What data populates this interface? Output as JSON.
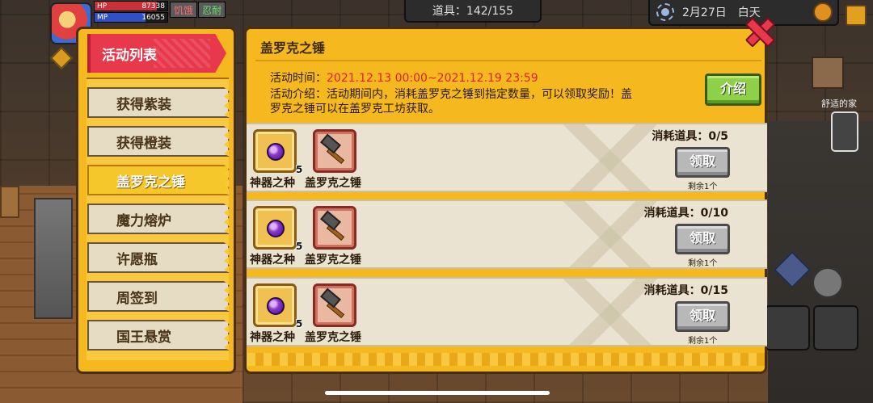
{
  "hud": {
    "hp_label": "HP",
    "hp_value": "87338",
    "hp_fill": 0.85,
    "mp_label": "MP",
    "mp_value": "16055",
    "mp_fill": 0.7,
    "status_hungry": "饥饿",
    "status_tired": "忍耐",
    "items_counter": "道具：142/155",
    "date": "2月27日",
    "time_of_day": "白天",
    "home_label": "舒适的家"
  },
  "sidebar": {
    "header": "活动列表",
    "items": [
      {
        "label": "获得紫装",
        "active": false
      },
      {
        "label": "获得橙装",
        "active": false
      },
      {
        "label": "盖罗克之锤",
        "active": true
      },
      {
        "label": "魔力熔炉",
        "active": false
      },
      {
        "label": "许愿瓶",
        "active": false
      },
      {
        "label": "周签到",
        "active": false
      },
      {
        "label": "国王悬赏",
        "active": false
      }
    ]
  },
  "detail": {
    "title": "盖罗克之锤",
    "time_label": "活动时间：",
    "time_value": "2021.12.13 00:00~2021.12.19 23:59",
    "desc_line1": "活动介绍：活动期间内，消耗盖罗克之锤到指定数量，可以领取奖励！盖",
    "desc_line2": "罗克之锤可以在盖罗克工坊获取。",
    "intro_button": "介绍"
  },
  "tasks": [
    {
      "reward_name": "神器之种",
      "reward_qty": "5",
      "cost_name": "盖罗克之锤",
      "consume": "消耗道具：0/5",
      "claim": "领取",
      "remain": "剩余1个"
    },
    {
      "reward_name": "神器之种",
      "reward_qty": "5",
      "cost_name": "盖罗克之锤",
      "consume": "消耗道具：0/10",
      "claim": "领取",
      "remain": "剩余1个"
    },
    {
      "reward_name": "神器之种",
      "reward_qty": "5",
      "cost_name": "盖罗克之锤",
      "consume": "消耗道具：0/15",
      "claim": "领取",
      "remain": "剩余1个"
    }
  ],
  "icons": [
    "close-icon",
    "sun-icon",
    "globe-icon",
    "exit-icon",
    "phone-icon",
    "seed-icon",
    "hammer-icon"
  ],
  "colors": {
    "accent_red": "#e8384c",
    "panel_gold": "#f5b81e",
    "time_red": "#e02020",
    "button_green": "#8ed048"
  }
}
